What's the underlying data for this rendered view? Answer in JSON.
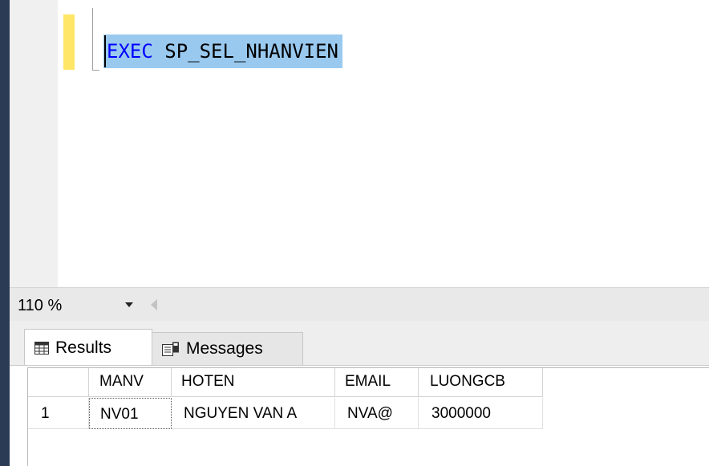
{
  "editor": {
    "keyword": "EXEC",
    "procedure": " SP_SEL_NHANVIEN"
  },
  "zoom": {
    "value": "110 %"
  },
  "tabs": [
    {
      "label": "Results",
      "icon": "grid-icon"
    },
    {
      "label": "Messages",
      "icon": "messages-icon"
    }
  ],
  "results": {
    "columns": [
      "MANV",
      "HOTEN",
      "EMAIL",
      "LUONGCB"
    ],
    "rows": [
      {
        "num": "1",
        "cells": [
          "NV01",
          "NGUYEN VAN A",
          "NVA@",
          "3000000"
        ]
      }
    ]
  },
  "colors": {
    "selection": "#99c9ef",
    "keyword": "#0000ff",
    "change_bar": "#ffe667"
  }
}
